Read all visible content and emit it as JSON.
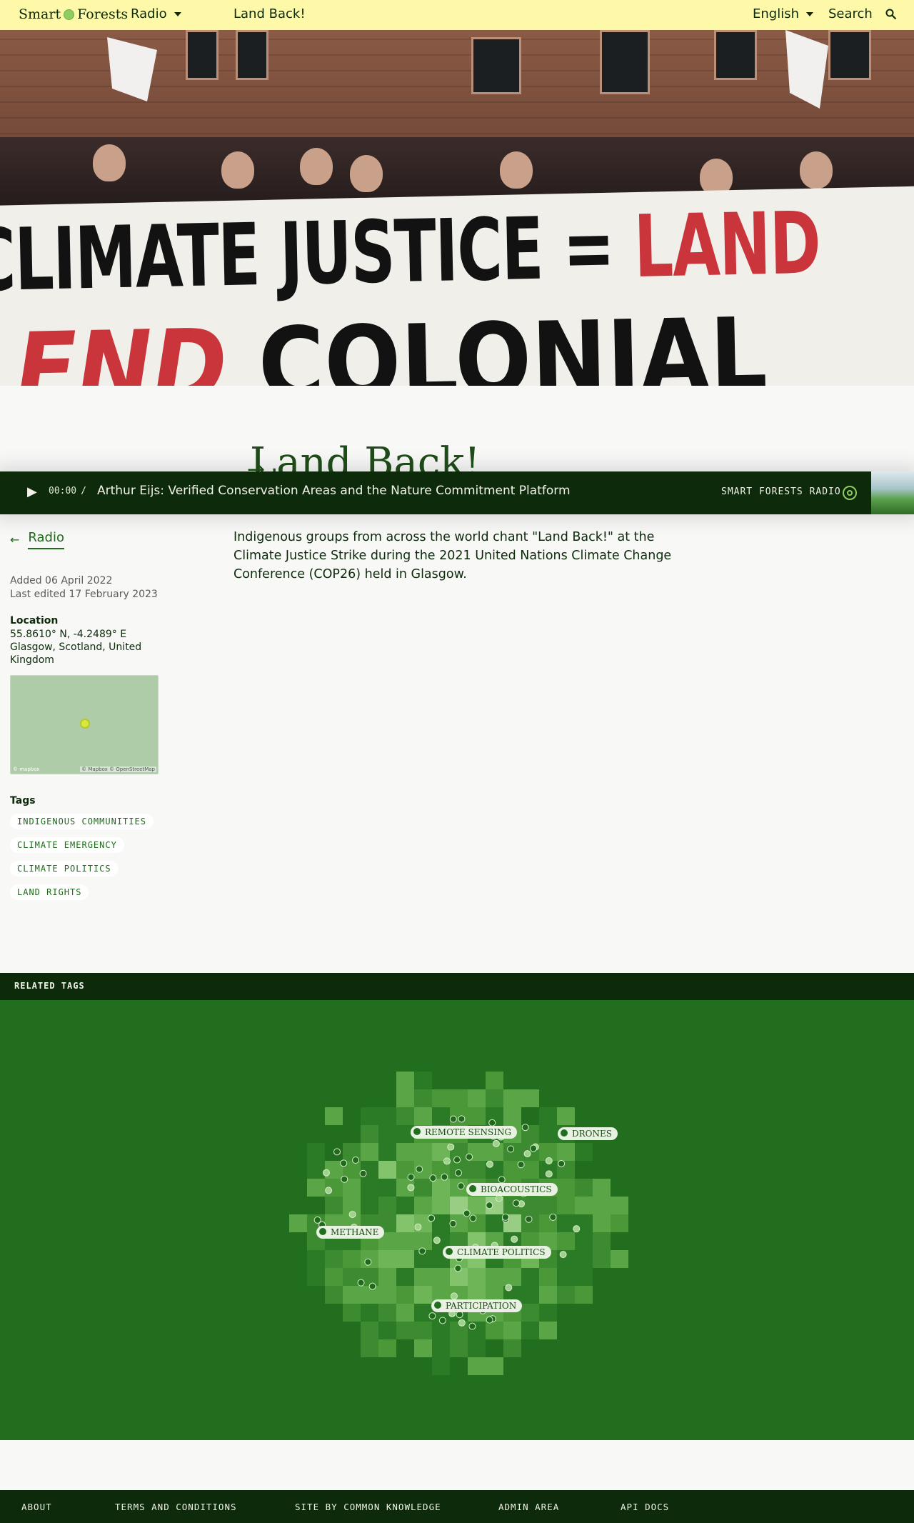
{
  "nav": {
    "brand_left": "Smart",
    "brand_right": "Forests",
    "radio": "Radio",
    "page": "Land Back!",
    "language": "English",
    "search": "Search"
  },
  "hero": {
    "banner_line1_a": "CLIMATE JUSTICE = ",
    "banner_line1_b": "LAND",
    "banner_line2_a": "END ",
    "banner_line2_b": "COLONIAL"
  },
  "page": {
    "title": "Land Back!"
  },
  "player": {
    "time": "00:00",
    "separator": "/",
    "track": "Arthur Eijs: Verified Conservation Areas and the Nature Commitment Platform",
    "station": "SMART FORESTS RADIO"
  },
  "sidebar": {
    "back": "Radio",
    "added": "Added 06 April 2022",
    "edited": "Last edited 17 February 2023",
    "location_heading": "Location",
    "coords": "55.8610° N, -4.2489° E",
    "place": "Glasgow, Scotland, United Kingdom",
    "map_logo": "© mapbox",
    "map_attribution": "© Mapbox © OpenStreetMap",
    "tags_heading": "Tags",
    "tags": [
      "INDIGENOUS COMMUNITIES",
      "CLIMATE EMERGENCY",
      "CLIMATE POLITICS",
      "LAND RIGHTS"
    ]
  },
  "description": "Indigenous groups from across the world chant \"Land Back!\" at the Climate Justice Strike during the 2021 United Nations Climate Change Conference (COP26) held in Glasgow.",
  "related": {
    "heading": "RELATED TAGS",
    "labels": [
      "REMOTE SENSING",
      "DRONES",
      "BIOACOUSTICS",
      "METHANE",
      "CLIMATE POLITICS",
      "PARTICIPATION"
    ]
  },
  "footer": [
    "ABOUT",
    "TERMS AND CONDITIONS",
    "SITE BY COMMON KNOWLEDGE",
    "ADMIN AREA",
    "API DOCS"
  ],
  "colors": {
    "nav_bg": "#fdf9a8",
    "dark_green": "#0d2a0b",
    "accent_green": "#1f6a1a",
    "tag_map_bg": "#216e1f",
    "light_green": "#8fcd62"
  }
}
